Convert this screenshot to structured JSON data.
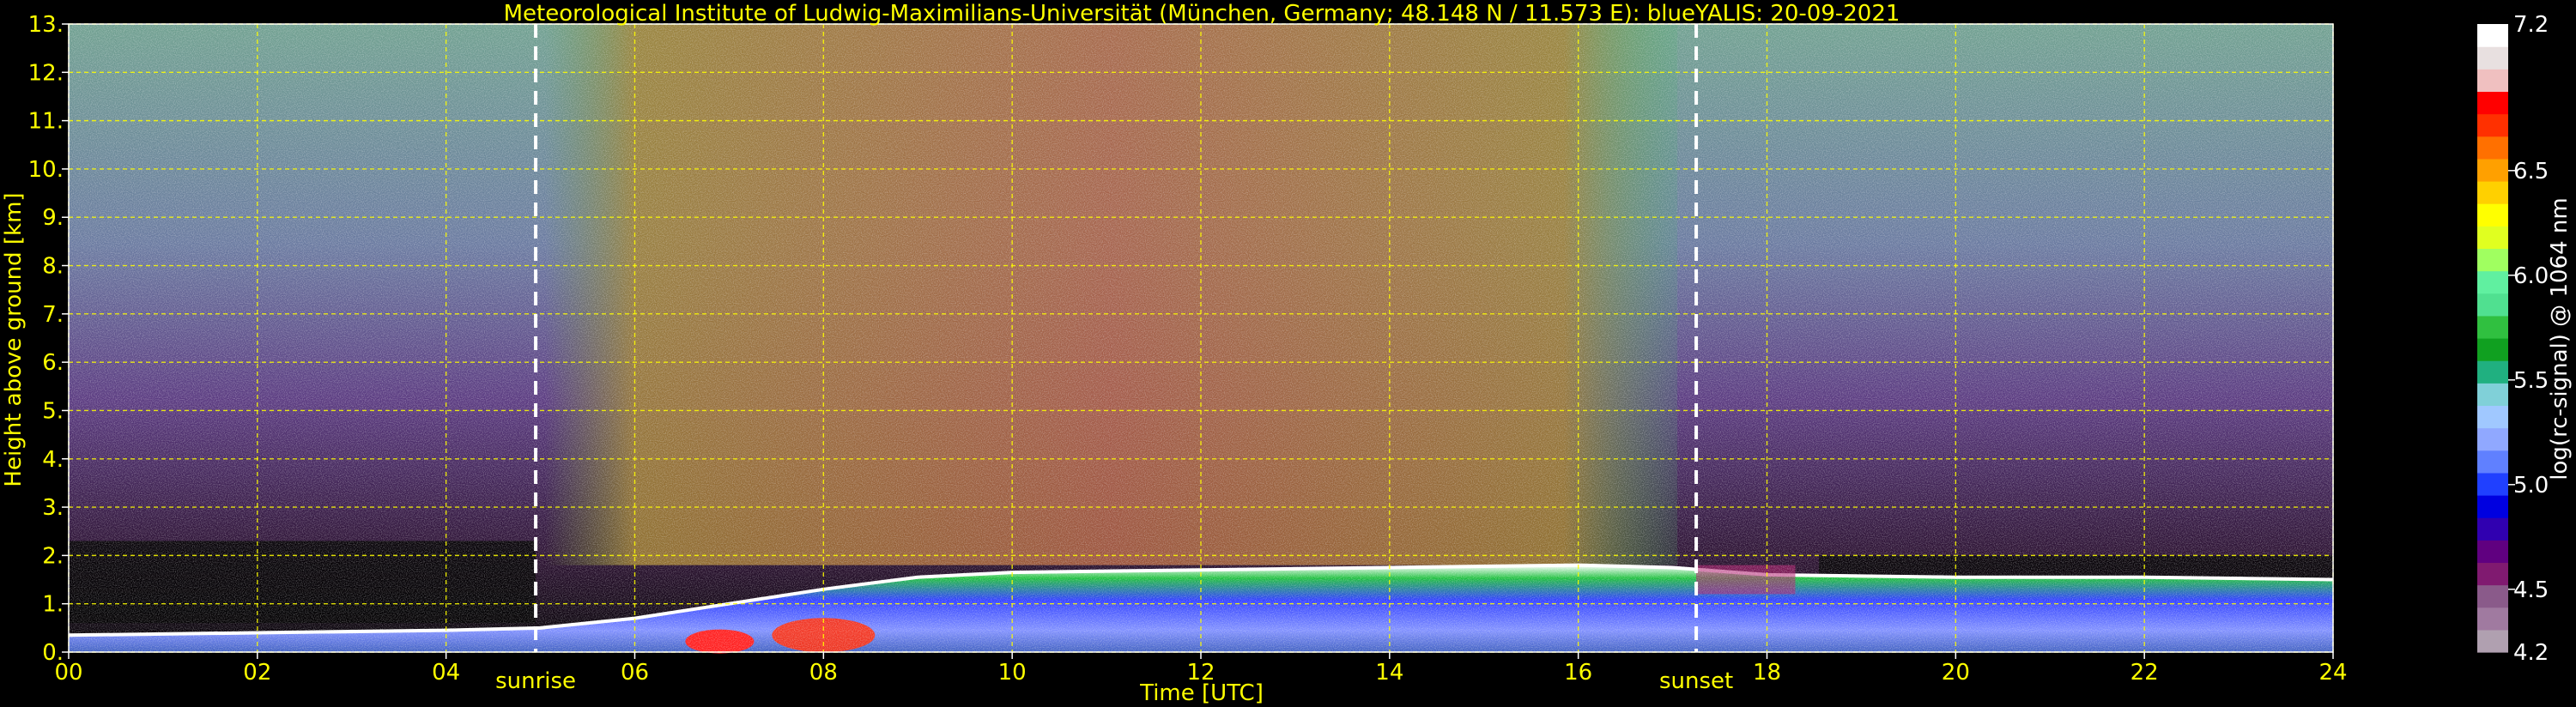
{
  "chart_data": {
    "type": "heatmap",
    "title": "Meteorological Institute of Ludwig-Maximilians-Universität (München, Germany; 48.148 N / 11.573 E):     blueYALIS: 20-09-2021",
    "xlabel": "Time [UTC]",
    "ylabel": "Height above ground [km]",
    "xlim": [
      0,
      24
    ],
    "ylim": [
      0,
      13
    ],
    "x_ticks": [
      0,
      2,
      4,
      6,
      8,
      10,
      12,
      14,
      16,
      18,
      20,
      22,
      24
    ],
    "x_tick_labels": [
      "00",
      "02",
      "04",
      "06",
      "08",
      "10",
      "12",
      "14",
      "16",
      "18",
      "20",
      "22",
      "24"
    ],
    "y_ticks": [
      0,
      1,
      2,
      3,
      4,
      5,
      6,
      7,
      8,
      9,
      10,
      11,
      12,
      13
    ],
    "y_tick_labels": [
      "0.",
      "1.",
      "2.",
      "3.",
      "4.",
      "5.",
      "6.",
      "7.",
      "8.",
      "9.",
      "10.",
      "11.",
      "12.",
      "13."
    ],
    "grid": true,
    "grid_color": "#ffff00",
    "annotations": [
      {
        "text": "sunrise",
        "x": 4.95
      },
      {
        "text": "sunset",
        "x": 17.25
      }
    ],
    "colorbar": {
      "label": "log(rc-signal) @ 1064 nm",
      "range": [
        4.2,
        7.2
      ],
      "tick_values": [
        4.5,
        5.0,
        5.5,
        6.0,
        6.5
      ],
      "tick_labels": [
        "4.5",
        "5.0",
        "5.5",
        "6.0",
        "6.5"
      ],
      "end_labels": [
        "4.2",
        "7.2"
      ],
      "colors": [
        "#b0a0b0",
        "#a07aa0",
        "#8a5a8a",
        "#801a70",
        "#600080",
        "#3000b0",
        "#0000e0",
        "#2040ff",
        "#6080ff",
        "#90a8ff",
        "#a0c8ff",
        "#80d0d8",
        "#20b080",
        "#10a020",
        "#30c040",
        "#50e090",
        "#60f0a0",
        "#a0ff60",
        "#e0ff20",
        "#ffff00",
        "#ffd000",
        "#ffa000",
        "#ff7000",
        "#ff3000",
        "#ff0000",
        "#f0c0c0",
        "#e8e0e0",
        "#ffffff"
      ]
    },
    "features": {
      "boundary_layer_top_km": [
        [
          0,
          0.35
        ],
        [
          2,
          0.4
        ],
        [
          4,
          0.45
        ],
        [
          5,
          0.5
        ],
        [
          6,
          0.7
        ],
        [
          7,
          1.0
        ],
        [
          8,
          1.3
        ],
        [
          9,
          1.55
        ],
        [
          10,
          1.65
        ],
        [
          12,
          1.7
        ],
        [
          14,
          1.75
        ],
        [
          16,
          1.8
        ],
        [
          17,
          1.75
        ],
        [
          18,
          1.6
        ],
        [
          20,
          1.55
        ],
        [
          22,
          1.55
        ],
        [
          24,
          1.5
        ]
      ],
      "sunrise_hour": 4.95,
      "sunset_hour": 17.25
    }
  }
}
